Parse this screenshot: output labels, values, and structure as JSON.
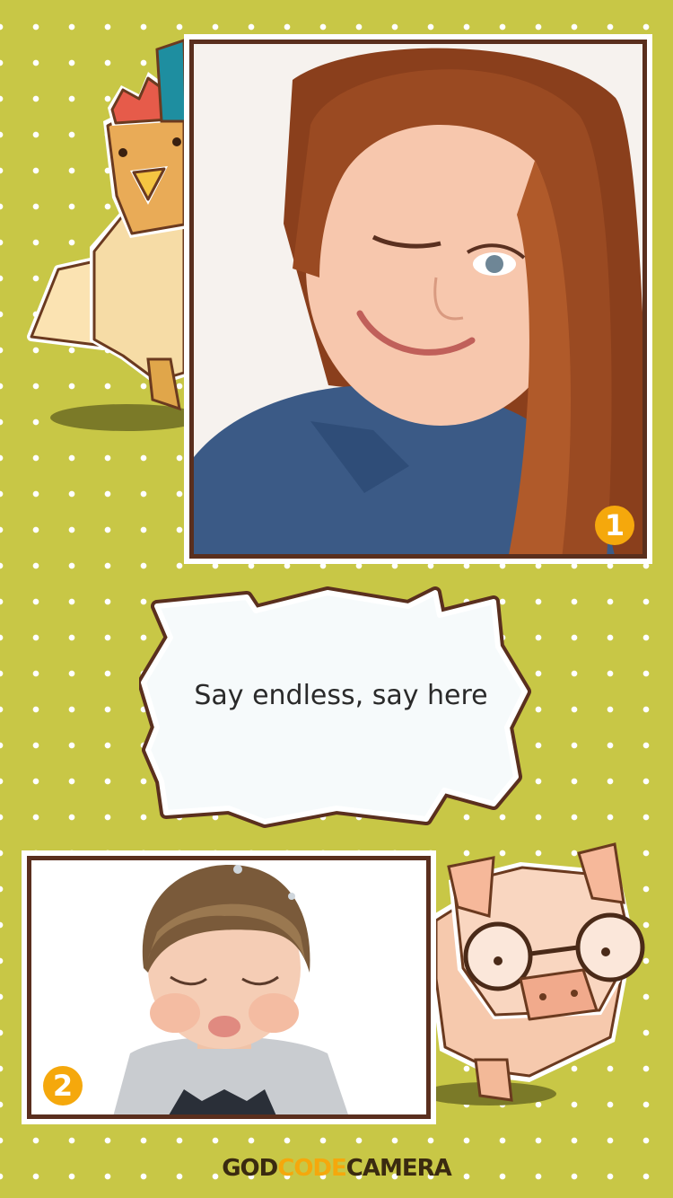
{
  "caption": {
    "text": "Say endless, say here"
  },
  "badges": [
    "1",
    "2"
  ],
  "brand": {
    "part1": "GOD",
    "part2": "CODE",
    "part3": "CAMERA"
  },
  "colors": {
    "background": "#c8c746",
    "frame_border": "#5a2f1e",
    "badge": "#f5a80c",
    "brand_dark": "#3a2a10",
    "brand_accent": "#f5a80c"
  },
  "icons": [
    "chicken-illustration",
    "pig-illustration"
  ]
}
